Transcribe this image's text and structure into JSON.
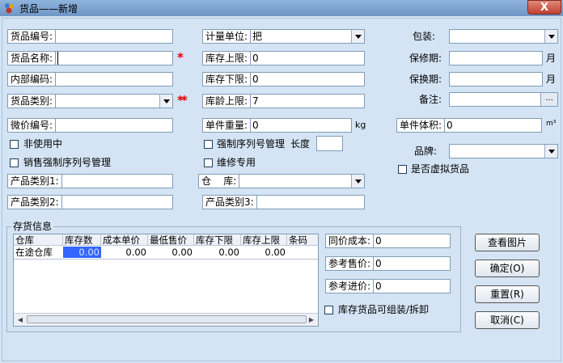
{
  "window": {
    "title": "货品——新增",
    "close_label": "X"
  },
  "col1": {
    "item_code": {
      "label": "货品编号:",
      "value": ""
    },
    "item_name": {
      "label": "货品名称:",
      "value": ""
    },
    "internal_code": {
      "label": "内部编码:",
      "value": ""
    },
    "item_category": {
      "label": "货品类别:",
      "value": ""
    },
    "micro_price_code": {
      "label": "微价编号:",
      "value": ""
    },
    "not_in_use": "非使用中",
    "sales_force_serial": "销售强制序列号管理",
    "product_cat1": {
      "label": "产品类别1:",
      "value": ""
    },
    "product_cat2": {
      "label": "产品类别2:",
      "value": ""
    }
  },
  "col2": {
    "unit": {
      "label": "计量单位:",
      "value": "把"
    },
    "stock_upper": {
      "label": "库存上限:",
      "value": "0"
    },
    "stock_lower": {
      "label": "库存下限:",
      "value": "0"
    },
    "age_upper": {
      "label": "库龄上限:",
      "value": "7"
    },
    "unit_weight": {
      "label": "单件重量:",
      "value": "0"
    },
    "weight_unit": "kg",
    "force_serial": "强制序列号管理",
    "length_label": "长度",
    "length_value": "",
    "repair_only": "维修专用",
    "warehouse": {
      "label": "仓    库:",
      "value": ""
    },
    "product_cat3": {
      "label": "产品类别3:",
      "value": ""
    }
  },
  "col3": {
    "packaging": {
      "label": "包装:",
      "value": ""
    },
    "warranty": {
      "label": "保修期:",
      "value": ""
    },
    "warranty_unit": "月",
    "exchange": {
      "label": "保换期:",
      "value": ""
    },
    "exchange_unit": "月",
    "remarks": {
      "label": "备注:",
      "value": ""
    },
    "browse_label": "...",
    "unit_volume": {
      "label": "单件体积:",
      "value": "0"
    },
    "volume_unit": "m³",
    "brand": {
      "label": "品牌:",
      "value": ""
    },
    "virtual_item": "是否虚拟货品"
  },
  "inventory": {
    "group_title": "存货信息",
    "headers": [
      "仓库",
      "库存数",
      "成本单价",
      "最低售价",
      "库存下限",
      "库存上限",
      "条码"
    ],
    "rows": [
      [
        "在途仓库",
        "0.00",
        "0.00",
        "0.00",
        "0.00",
        "0.00",
        ""
      ]
    ],
    "same_price_cost": {
      "label": "同价成本:",
      "value": "0"
    },
    "ref_sale_price": {
      "label": "参考售价:",
      "value": "0"
    },
    "ref_purchase_price": {
      "label": "参考进价:",
      "value": "0"
    },
    "assemble_check": "库存货品可组装/拆卸"
  },
  "buttons": {
    "view_image": "查看图片",
    "ok": "确定(O)",
    "reset": "重置(R)",
    "cancel": "取消(C)"
  },
  "colors": {
    "required_star": "#e00000",
    "selected_cell": "#3366ff",
    "window_bg": "#d4e4f4"
  }
}
